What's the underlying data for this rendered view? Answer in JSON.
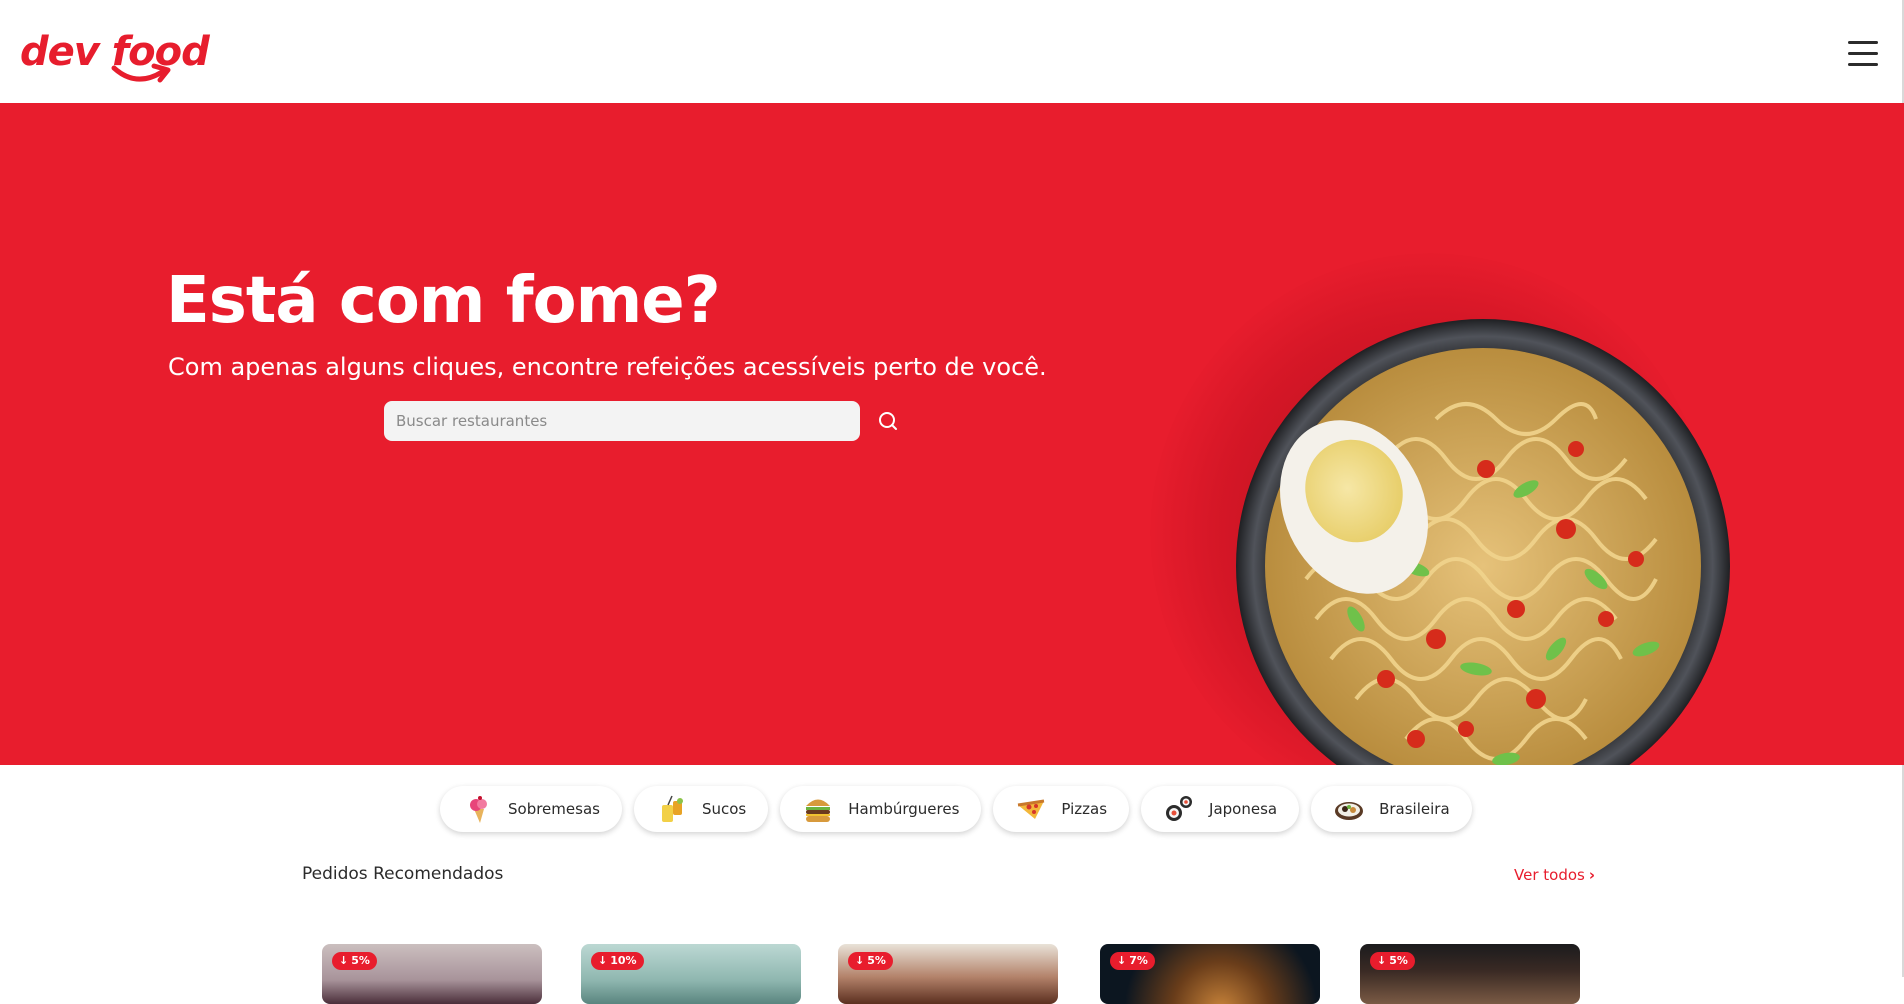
{
  "header": {
    "logo_text": "dev food",
    "menu_icon": "hamburger-menu-icon"
  },
  "hero": {
    "title": "Está com fome?",
    "subtitle": "Com apenas alguns cliques, encontre refeições acessíveis perto de você.",
    "search_placeholder": "Buscar restaurantes",
    "search_value": "",
    "search_icon": "search-icon"
  },
  "categories": [
    {
      "label": "Sobremesas",
      "icon": "ice-cream-icon"
    },
    {
      "label": "Sucos",
      "icon": "juice-icon"
    },
    {
      "label": "Hambúrgueres",
      "icon": "burger-icon"
    },
    {
      "label": "Pizzas",
      "icon": "pizza-icon"
    },
    {
      "label": "Japonesa",
      "icon": "sushi-icon"
    },
    {
      "label": "Brasileira",
      "icon": "brazilian-dish-icon"
    }
  ],
  "recommended": {
    "title": "Pedidos Recomendados",
    "see_all": "Ver todos",
    "products": [
      {
        "discount": "5%"
      },
      {
        "discount": "10%"
      },
      {
        "discount": "5%"
      },
      {
        "discount": "7%"
      },
      {
        "discount": "5%"
      }
    ]
  },
  "colors": {
    "brand_red": "#e81d2d",
    "text_dark": "#2b2b2b",
    "white": "#ffffff"
  }
}
